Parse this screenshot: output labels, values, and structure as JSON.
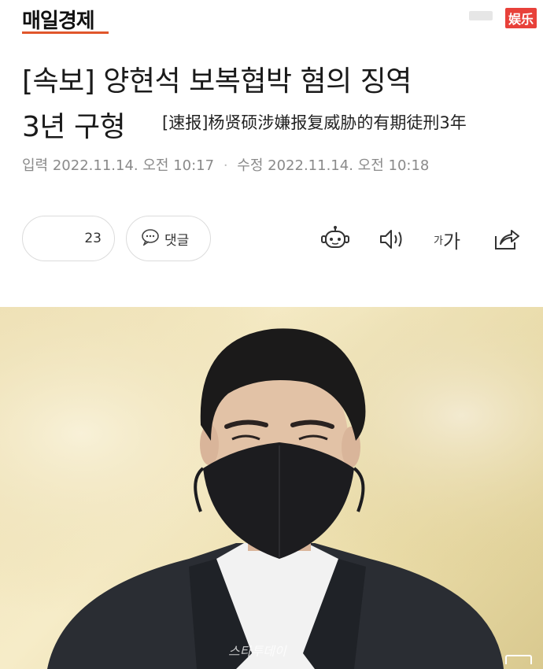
{
  "header": {
    "logo_text": "매일경제",
    "badge_text": "娱乐",
    "logo_accent_color": "#e0562b",
    "badge_color": "#e8413a"
  },
  "article": {
    "title_line1": "[속보] 양현석 보복협박 혐의 징역",
    "title_line2": "3년 구형",
    "subtitle": "[速报]杨贤硕涉嫌报复威胁的有期徒刑3年",
    "input_label": "입력",
    "input_date": "2022.11.14. 오전 10:17",
    "dot": "·",
    "edit_label": "수정",
    "edit_date": "2022.11.14. 오전 10:18"
  },
  "actions": {
    "like_count": "23",
    "comment_label": "댓글",
    "icons": [
      "robot-summary-icon",
      "audio-icon",
      "font-size-icon",
      "share-icon"
    ],
    "font_small": "가",
    "font_large": "가"
  },
  "photo": {
    "watermark": "스타투데이"
  }
}
